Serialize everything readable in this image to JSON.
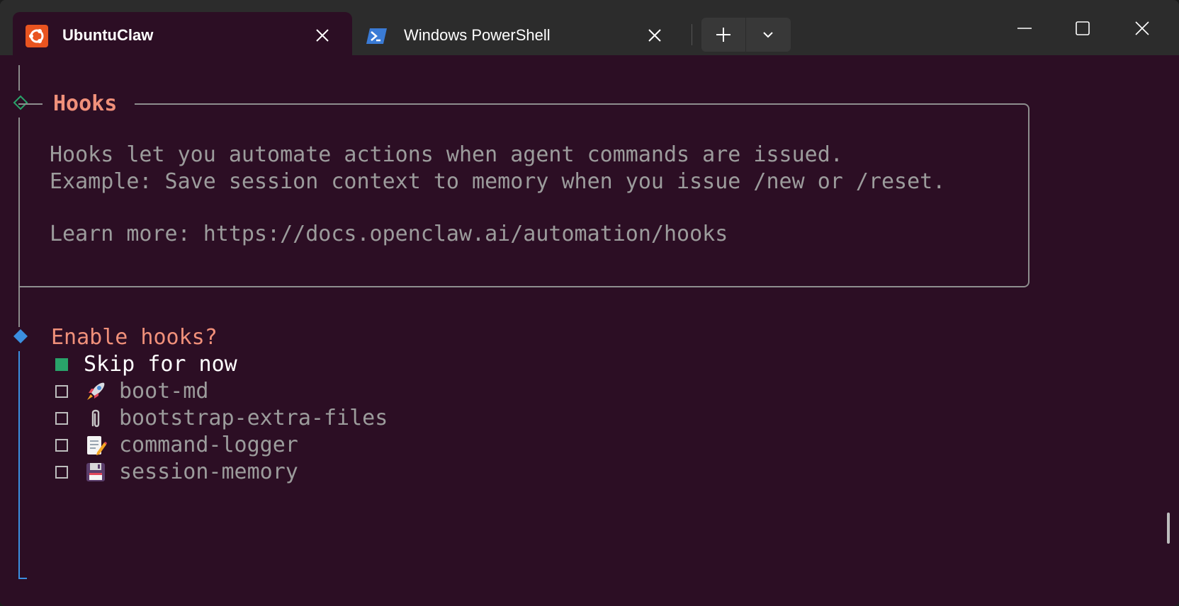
{
  "tabs": [
    {
      "title": "UbuntuClaw",
      "icon": "ubuntu-icon",
      "active": true
    },
    {
      "title": "Windows PowerShell",
      "icon": "powershell-icon",
      "active": false
    }
  ],
  "window_controls": [
    "minimize-icon",
    "maximize-icon",
    "close-icon"
  ],
  "colors": {
    "terminal_bg": "#2c0e24",
    "accent_orange": "#f0907a",
    "accent_green": "#29a36a",
    "accent_blue": "#3b8fe0",
    "muted_text": "#9c9c9c"
  },
  "terminal": {
    "hooks_title": "Hooks",
    "description_line1": "Hooks let you automate actions when agent commands are issued.",
    "description_line2": "Example: Save session context to memory when you issue /new or /reset.",
    "learn_more": "Learn more: https://docs.openclaw.ai/automation/hooks",
    "prompt": "Enable hooks?",
    "options": [
      {
        "label": "Skip for now",
        "checked": true,
        "icon": "none"
      },
      {
        "label": "boot-md",
        "checked": false,
        "icon": "rocket-icon"
      },
      {
        "label": "bootstrap-extra-files",
        "checked": false,
        "icon": "paperclip-icon"
      },
      {
        "label": "command-logger",
        "checked": false,
        "icon": "memo-icon"
      },
      {
        "label": "session-memory",
        "checked": false,
        "icon": "floppy-disk-icon"
      }
    ]
  }
}
